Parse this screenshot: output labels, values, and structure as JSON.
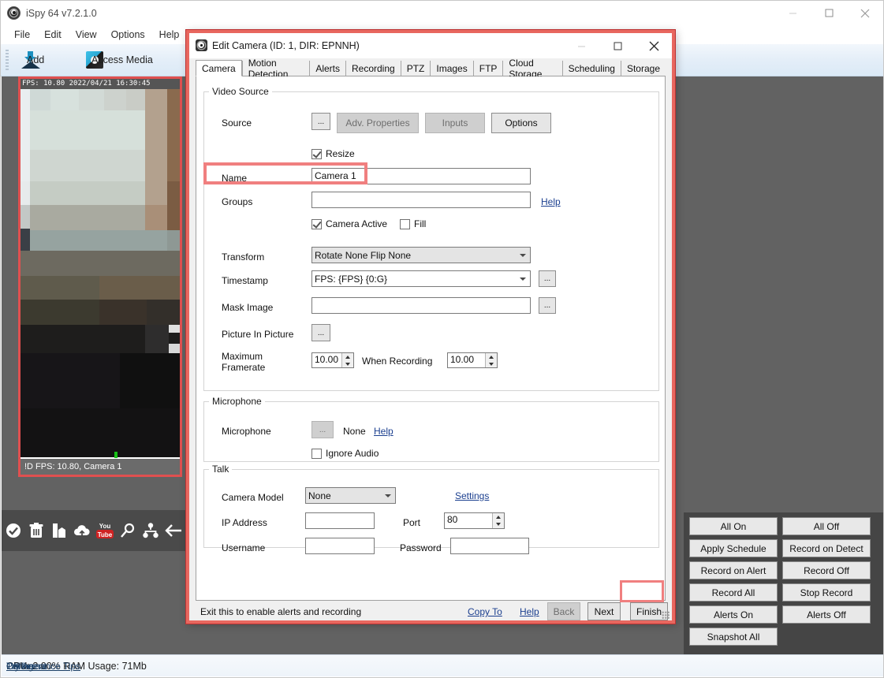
{
  "app": {
    "title": "iSpy 64 v7.2.1.0",
    "logo_icon": "ispy-eye-logo",
    "window_controls": {
      "minimize": "minimize-icon",
      "maximize": "maximize-icon",
      "close": "close-icon"
    },
    "menu": [
      "File",
      "Edit",
      "View",
      "Options",
      "Help"
    ],
    "toolbar": [
      {
        "label": "Add",
        "icon": "add-download-icon"
      },
      {
        "label": "Access Media",
        "icon": "media-camera-icon"
      }
    ]
  },
  "camera_preview": {
    "top_overlay": "FPS: 10.80 2022/04/21 16:30:45",
    "bottom_overlay": "!D  FPS: 10.80, Camera 1",
    "led": "recording-led"
  },
  "camera_toolbar": [
    {
      "icon": "check-circle-icon"
    },
    {
      "icon": "trash-icon"
    },
    {
      "icon": "book-icon"
    },
    {
      "icon": "cloud-upload-icon"
    },
    {
      "icon": "youtube-icon",
      "label_top": "You",
      "label_bottom": "Tube"
    },
    {
      "icon": "magnifier-icon"
    },
    {
      "icon": "network-share-icon"
    },
    {
      "icon": "back-arrow-icon"
    }
  ],
  "right_panel": {
    "rows": [
      [
        "All On",
        "All Off"
      ],
      [
        "Apply Schedule",
        "Record on Detect"
      ],
      [
        "Record on Alert",
        "Record Off"
      ],
      [
        "Record All",
        "Stop Record"
      ],
      [
        "Alerts On",
        "Alerts Off"
      ],
      [
        "Snapshot All"
      ]
    ]
  },
  "status_bar": {
    "offline": "Offline",
    "cpu": "CPU: 2.00% RAM Usage: 71Mb",
    "performance_tips": "Performance Tips",
    "try_agent": "Try Agent"
  },
  "dialog": {
    "title": "Edit Camera (ID: 1, DIR: EPNNH)",
    "logo_icon": "ispy-eye-logo",
    "window_controls": {
      "minimize": "minimize-icon",
      "maximize": "maximize-icon",
      "close": "close-icon"
    },
    "tabs": [
      "Camera",
      "Motion Detection",
      "Alerts",
      "Recording",
      "PTZ",
      "Images",
      "FTP",
      "Cloud Storage",
      "Scheduling",
      "Storage"
    ],
    "active_tab": "Camera",
    "video_source": {
      "legend": "Video Source",
      "source_label": "Source",
      "browse_label": "...",
      "adv_properties_label": "Adv. Properties",
      "inputs_label": "Inputs",
      "options_label": "Options",
      "resize_label": "Resize",
      "resize_checked": true,
      "name_label": "Name",
      "name_value": "Camera 1",
      "groups_label": "Groups",
      "groups_value": "",
      "groups_help": "Help",
      "camera_active_label": "Camera Active",
      "camera_active_checked": true,
      "fill_label": "Fill",
      "fill_checked": false,
      "transform_label": "Transform",
      "transform_value": "Rotate None Flip None",
      "timestamp_label": "Timestamp",
      "timestamp_value": "FPS: {FPS} {0:G}",
      "timestamp_browse": "...",
      "mask_image_label": "Mask Image",
      "mask_image_value": "",
      "mask_browse": "...",
      "pip_label": "Picture In Picture",
      "pip_browse": "...",
      "max_framerate_label": "Maximum\nFramerate",
      "max_framerate_value": "10.00",
      "when_recording_label": "When Recording",
      "when_recording_value": "10.00"
    },
    "microphone": {
      "legend": "Microphone",
      "label": "Microphone",
      "browse_label": "...",
      "value": "None",
      "help": "Help",
      "ignore_audio_label": "Ignore Audio",
      "ignore_audio_checked": false
    },
    "talk": {
      "legend": "Talk",
      "camera_model_label": "Camera Model",
      "camera_model_value": "None",
      "settings_link": "Settings",
      "ip_address_label": "IP Address",
      "ip_address_value": "",
      "port_label": "Port",
      "port_value": "80",
      "username_label": "Username",
      "username_value": "",
      "password_label": "Password",
      "password_value": ""
    },
    "footer": {
      "hint": "Exit this to enable alerts and recording",
      "copy_to": "Copy To",
      "help": "Help",
      "back": "Back",
      "next": "Next",
      "finish": "Finish"
    }
  },
  "colors": {
    "highlight_red": "#f07f7f",
    "dialog_border": "#e8675f",
    "content_bg": "#626262",
    "right_panel_bg": "#454545",
    "link": "#1b3f8f"
  }
}
